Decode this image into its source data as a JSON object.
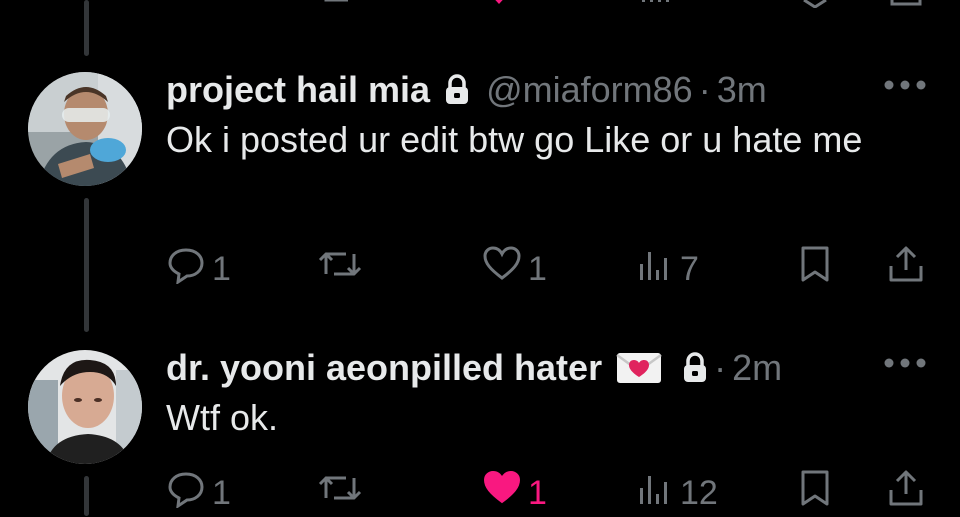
{
  "colors": {
    "background": "#000000",
    "text": "#e7e9ea",
    "muted": "#71767b",
    "like": "#f91880",
    "thread_line": "#333639"
  },
  "tweets": [
    {
      "name": "project hail mia",
      "handle": "@miaform86",
      "separator": "·",
      "time": "3m",
      "text": "Ok i posted ur edit btw go Like or u hate me",
      "replies": "1",
      "retweets": "",
      "likes": "1",
      "liked": false,
      "views": "7",
      "icons": [
        "lock-icon",
        "more-icon",
        "reply-icon",
        "retweet-icon",
        "heart-icon",
        "views-icon",
        "bookmark-icon",
        "share-icon"
      ]
    },
    {
      "name": "dr. yooni aeonpilled hater",
      "handle": "",
      "separator": "·",
      "time": "2m",
      "text": "Wtf ok.",
      "replies": "1",
      "retweets": "",
      "likes": "1",
      "liked": true,
      "views": "12",
      "icons": [
        "love-letter-icon",
        "lock-icon",
        "more-icon",
        "reply-icon",
        "retweet-icon",
        "heart-icon",
        "views-icon",
        "bookmark-icon",
        "share-icon"
      ]
    }
  ]
}
